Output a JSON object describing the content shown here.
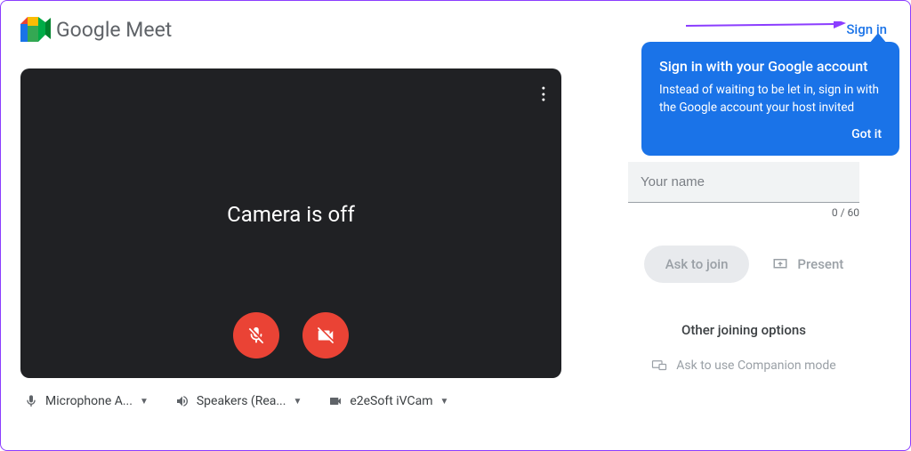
{
  "header": {
    "product_name": "Google Meet",
    "sign_in_label": "Sign in"
  },
  "callout": {
    "title": "Sign in with your Google account",
    "body": "Instead of waiting to be let in, sign in with the Google account your host invited",
    "action": "Got it"
  },
  "preview": {
    "status_text": "Camera is off"
  },
  "devices": {
    "mic_label": "Microphone A...",
    "speaker_label": "Speakers (Rea...",
    "camera_label": "e2eSoft iVCam"
  },
  "join": {
    "name_placeholder": "Your name",
    "name_value": "",
    "char_count": "0 / 60",
    "ask_label": "Ask to join",
    "present_label": "Present",
    "other_options": "Other joining options",
    "companion_label": "Ask to use Companion mode"
  }
}
